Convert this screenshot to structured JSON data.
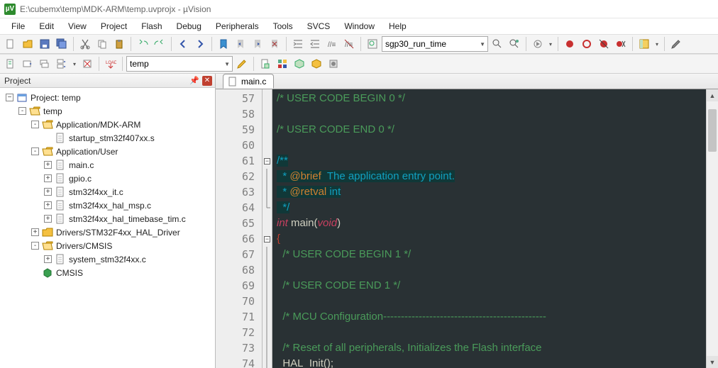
{
  "titlebar": {
    "path": "E:\\cubemx\\temp\\MDK-ARM\\temp.uvprojx - µVision"
  },
  "menu": [
    "File",
    "Edit",
    "View",
    "Project",
    "Flash",
    "Debug",
    "Peripherals",
    "Tools",
    "SVCS",
    "Window",
    "Help"
  ],
  "toolbar1": {
    "search_value": "sgp30_run_time"
  },
  "toolbar2": {
    "target_value": "temp"
  },
  "project_panel": {
    "title": "Project",
    "root": "Project: temp",
    "nodes": [
      {
        "lvl": 1,
        "toggle": "-",
        "icon": "folder-open",
        "label": "temp"
      },
      {
        "lvl": 2,
        "toggle": "-",
        "icon": "folder-open",
        "label": "Application/MDK-ARM"
      },
      {
        "lvl": 3,
        "toggle": " ",
        "icon": "asm-file",
        "label": "startup_stm32f407xx.s"
      },
      {
        "lvl": 2,
        "toggle": "-",
        "icon": "folder-open",
        "label": "Application/User"
      },
      {
        "lvl": 3,
        "toggle": "+",
        "icon": "c-file",
        "label": "main.c"
      },
      {
        "lvl": 3,
        "toggle": "+",
        "icon": "c-file",
        "label": "gpio.c"
      },
      {
        "lvl": 3,
        "toggle": "+",
        "icon": "c-file",
        "label": "stm32f4xx_it.c"
      },
      {
        "lvl": 3,
        "toggle": "+",
        "icon": "c-file",
        "label": "stm32f4xx_hal_msp.c"
      },
      {
        "lvl": 3,
        "toggle": "+",
        "icon": "c-file",
        "label": "stm32f4xx_hal_timebase_tim.c"
      },
      {
        "lvl": 2,
        "toggle": "+",
        "icon": "folder-closed",
        "label": "Drivers/STM32F4xx_HAL_Driver"
      },
      {
        "lvl": 2,
        "toggle": "-",
        "icon": "folder-open",
        "label": "Drivers/CMSIS"
      },
      {
        "lvl": 3,
        "toggle": "+",
        "icon": "c-file",
        "label": "system_stm32f4xx.c"
      },
      {
        "lvl": 2,
        "toggle": " ",
        "icon": "pack",
        "label": "CMSIS"
      }
    ]
  },
  "editor": {
    "tab_label": "main.c",
    "first_line": 57,
    "lines": [
      {
        "n": 57,
        "fold": "",
        "html": "<span class='c-comment'>/* USER CODE BEGIN 0 */</span>"
      },
      {
        "n": 58,
        "fold": "",
        "html": ""
      },
      {
        "n": 59,
        "fold": "",
        "html": "<span class='c-comment'>/* USER CODE END 0 */</span>"
      },
      {
        "n": 60,
        "fold": "",
        "html": ""
      },
      {
        "n": 61,
        "fold": "box",
        "html": "<span class='c-comment-block c-hl-bg'>/**</span>"
      },
      {
        "n": 62,
        "fold": "bar",
        "html": "<span class='c-comment-block c-hl-bg'>  * </span><span class='c-doctag c-hl-bg'>@brief</span><span class='c-comment-block c-hl-bg'>  The application entry point.</span>"
      },
      {
        "n": 63,
        "fold": "bar",
        "html": "<span class='c-comment-block c-hl-bg'>  * </span><span class='c-doctag c-hl-bg'>@retval</span><span class='c-comment-block c-hl-bg'> int</span>"
      },
      {
        "n": 64,
        "fold": "end",
        "html": "<span class='c-comment-block c-hl-bg'>  */</span>"
      },
      {
        "n": 65,
        "fold": "",
        "html": "<span class='c-kw'>int</span><span class='c-text'> </span><span class='c-func'>main</span><span class='c-text'>(</span><span class='c-kw'>void</span><span class='c-text'>)</span>"
      },
      {
        "n": 66,
        "fold": "box",
        "html": "<span class='c-brace'>{</span>"
      },
      {
        "n": 67,
        "fold": "bar",
        "html": "<span class='c-text'>  </span><span class='c-comment'>/* USER CODE BEGIN 1 */</span>"
      },
      {
        "n": 68,
        "fold": "bar",
        "html": ""
      },
      {
        "n": 69,
        "fold": "bar",
        "html": "<span class='c-text'>  </span><span class='c-comment'>/* USER CODE END 1 */</span>"
      },
      {
        "n": 70,
        "fold": "bar",
        "html": ""
      },
      {
        "n": 71,
        "fold": "bar",
        "html": "<span class='c-text'>  </span><span class='c-comment'>/* MCU Configuration----------------------------------------------</span>"
      },
      {
        "n": 72,
        "fold": "bar",
        "html": ""
      },
      {
        "n": 73,
        "fold": "bar",
        "html": "<span class='c-text'>  </span><span class='c-comment'>/* Reset of all peripherals, Initializes the Flash interface </span>"
      },
      {
        "n": 74,
        "fold": "bar",
        "html": "<span class='c-text'>  </span><span class='c-func'>HAL_Init</span><span class='c-text'>();</span>"
      }
    ]
  }
}
